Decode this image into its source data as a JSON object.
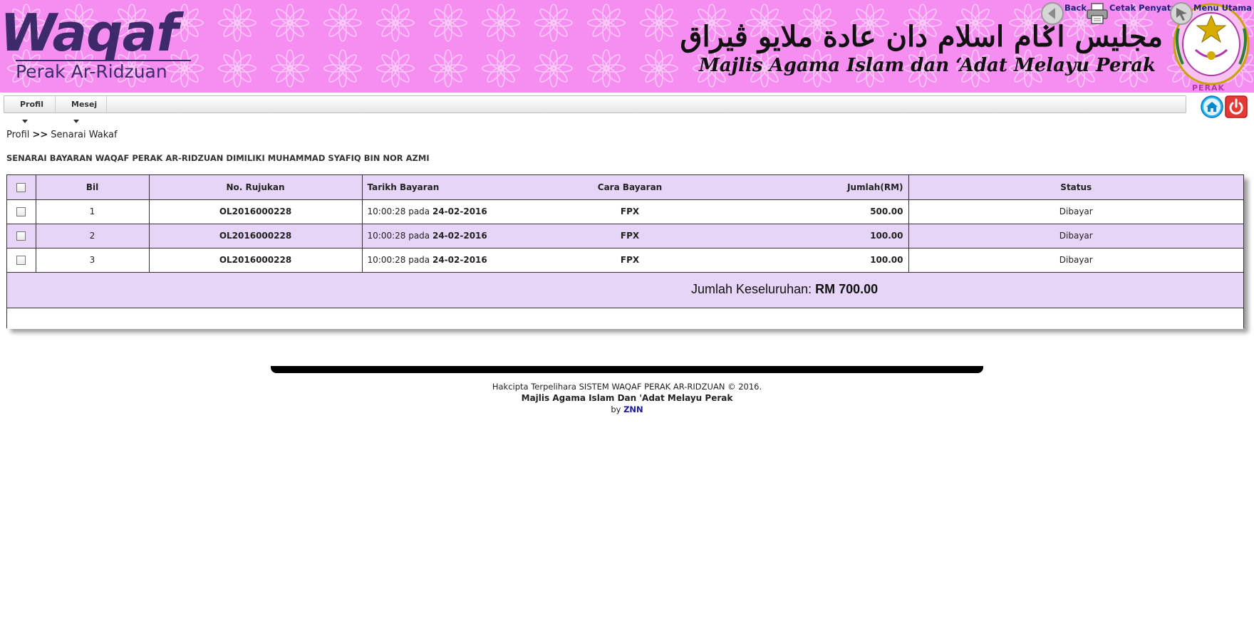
{
  "banner": {
    "logo_main": "Waqaf",
    "logo_sub": "Perak Ar-Ridzuan",
    "jawi_name": "مجليس اݢام اسلام دان عادة ملايو ڤيراق",
    "org_name": "Majlis Agama Islam dan ‘Adat Melayu Perak",
    "crest_label": "PERAK"
  },
  "menu": {
    "items": [
      {
        "label": "Profil"
      },
      {
        "label": "Mesej"
      }
    ],
    "home_icon": "home-icon",
    "logout_icon": "power-icon"
  },
  "breadcrumb": {
    "parent": "Profil",
    "separator": ">>",
    "current": "Senarai Wakaf"
  },
  "page_heading": "SENARAI BAYARAN WAQAF PERAK AR-RIDZUAN DIMILIKI MUHAMMAD SYAFIQ BIN NOR AZMI",
  "actions": {
    "back_label": "Back",
    "print_label": "Cetak Penyata",
    "menu_label": "Menu Utama"
  },
  "table": {
    "headers": {
      "bil": "Bil",
      "rujukan": "No. Rujukan",
      "tarikh": "Tarikh Bayaran",
      "cara": "Cara Bayaran",
      "jumlah": "Jumlah(RM)",
      "status": "Status"
    },
    "rows": [
      {
        "bil": "1",
        "rujukan": "OL2016000228",
        "time": "10:00:28 pada",
        "date": "24-02-2016",
        "cara": "FPX",
        "jumlah": "500.00",
        "status": "Dibayar"
      },
      {
        "bil": "2",
        "rujukan": "OL2016000228",
        "time": "10:00:28 pada",
        "date": "24-02-2016",
        "cara": "FPX",
        "jumlah": "100.00",
        "status": "Dibayar"
      },
      {
        "bil": "3",
        "rujukan": "OL2016000228",
        "time": "10:00:28 pada",
        "date": "24-02-2016",
        "cara": "FPX",
        "jumlah": "100.00",
        "status": "Dibayar"
      }
    ],
    "total_label": "Jumlah Keseluruhan:",
    "total_value": "RM 700.00"
  },
  "footer": {
    "copyright": "Hakcipta Terpelihara SISTEM WAQAF PERAK AR-RIDZUAN © 2016.",
    "org": "Majlis Agama Islam Dan 'Adat Melayu Perak",
    "by_label": "by",
    "by_link": "ZNN"
  },
  "colors": {
    "banner_bg": "#f58ef0",
    "logo": "#3d2a6b",
    "row_alt": "#e6d5f7",
    "status_paid": "#2e9e2e",
    "link": "#1a237e"
  }
}
